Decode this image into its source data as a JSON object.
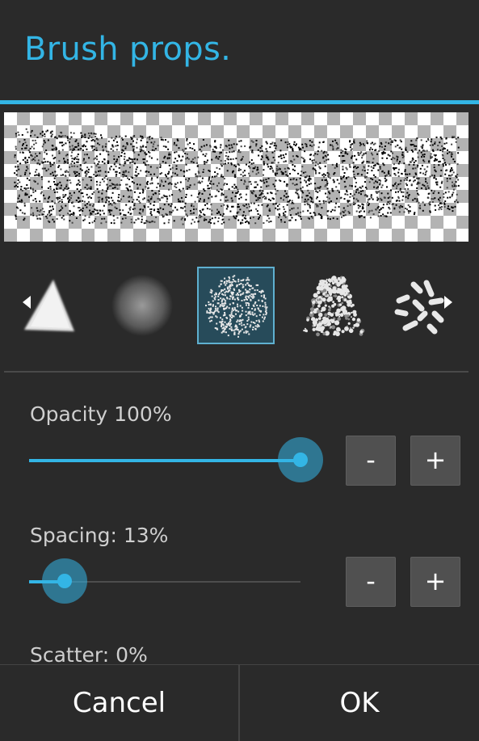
{
  "dialog": {
    "title": "Brush props."
  },
  "brushes": [
    {
      "icon": "triangle-brush-icon",
      "selected": false
    },
    {
      "icon": "soft-round-brush-icon",
      "selected": false
    },
    {
      "icon": "speckle-round-brush-icon",
      "selected": true
    },
    {
      "icon": "rough-texture-brush-icon",
      "selected": false
    },
    {
      "icon": "scatter-strokes-brush-icon",
      "selected": false
    }
  ],
  "opacity": {
    "label": "Opacity",
    "value_text": "100%",
    "value": 100,
    "minus_label": "-",
    "plus_label": "+"
  },
  "spacing": {
    "label": "Spacing:",
    "value_text": "13%",
    "value": 13,
    "minus_label": "-",
    "plus_label": "+"
  },
  "scatter": {
    "label": "Scatter:",
    "value_text": "0%"
  },
  "footer": {
    "cancel_label": "Cancel",
    "ok_label": "OK"
  },
  "colors": {
    "accent": "#33b5e5",
    "background": "#2a2a2a"
  }
}
